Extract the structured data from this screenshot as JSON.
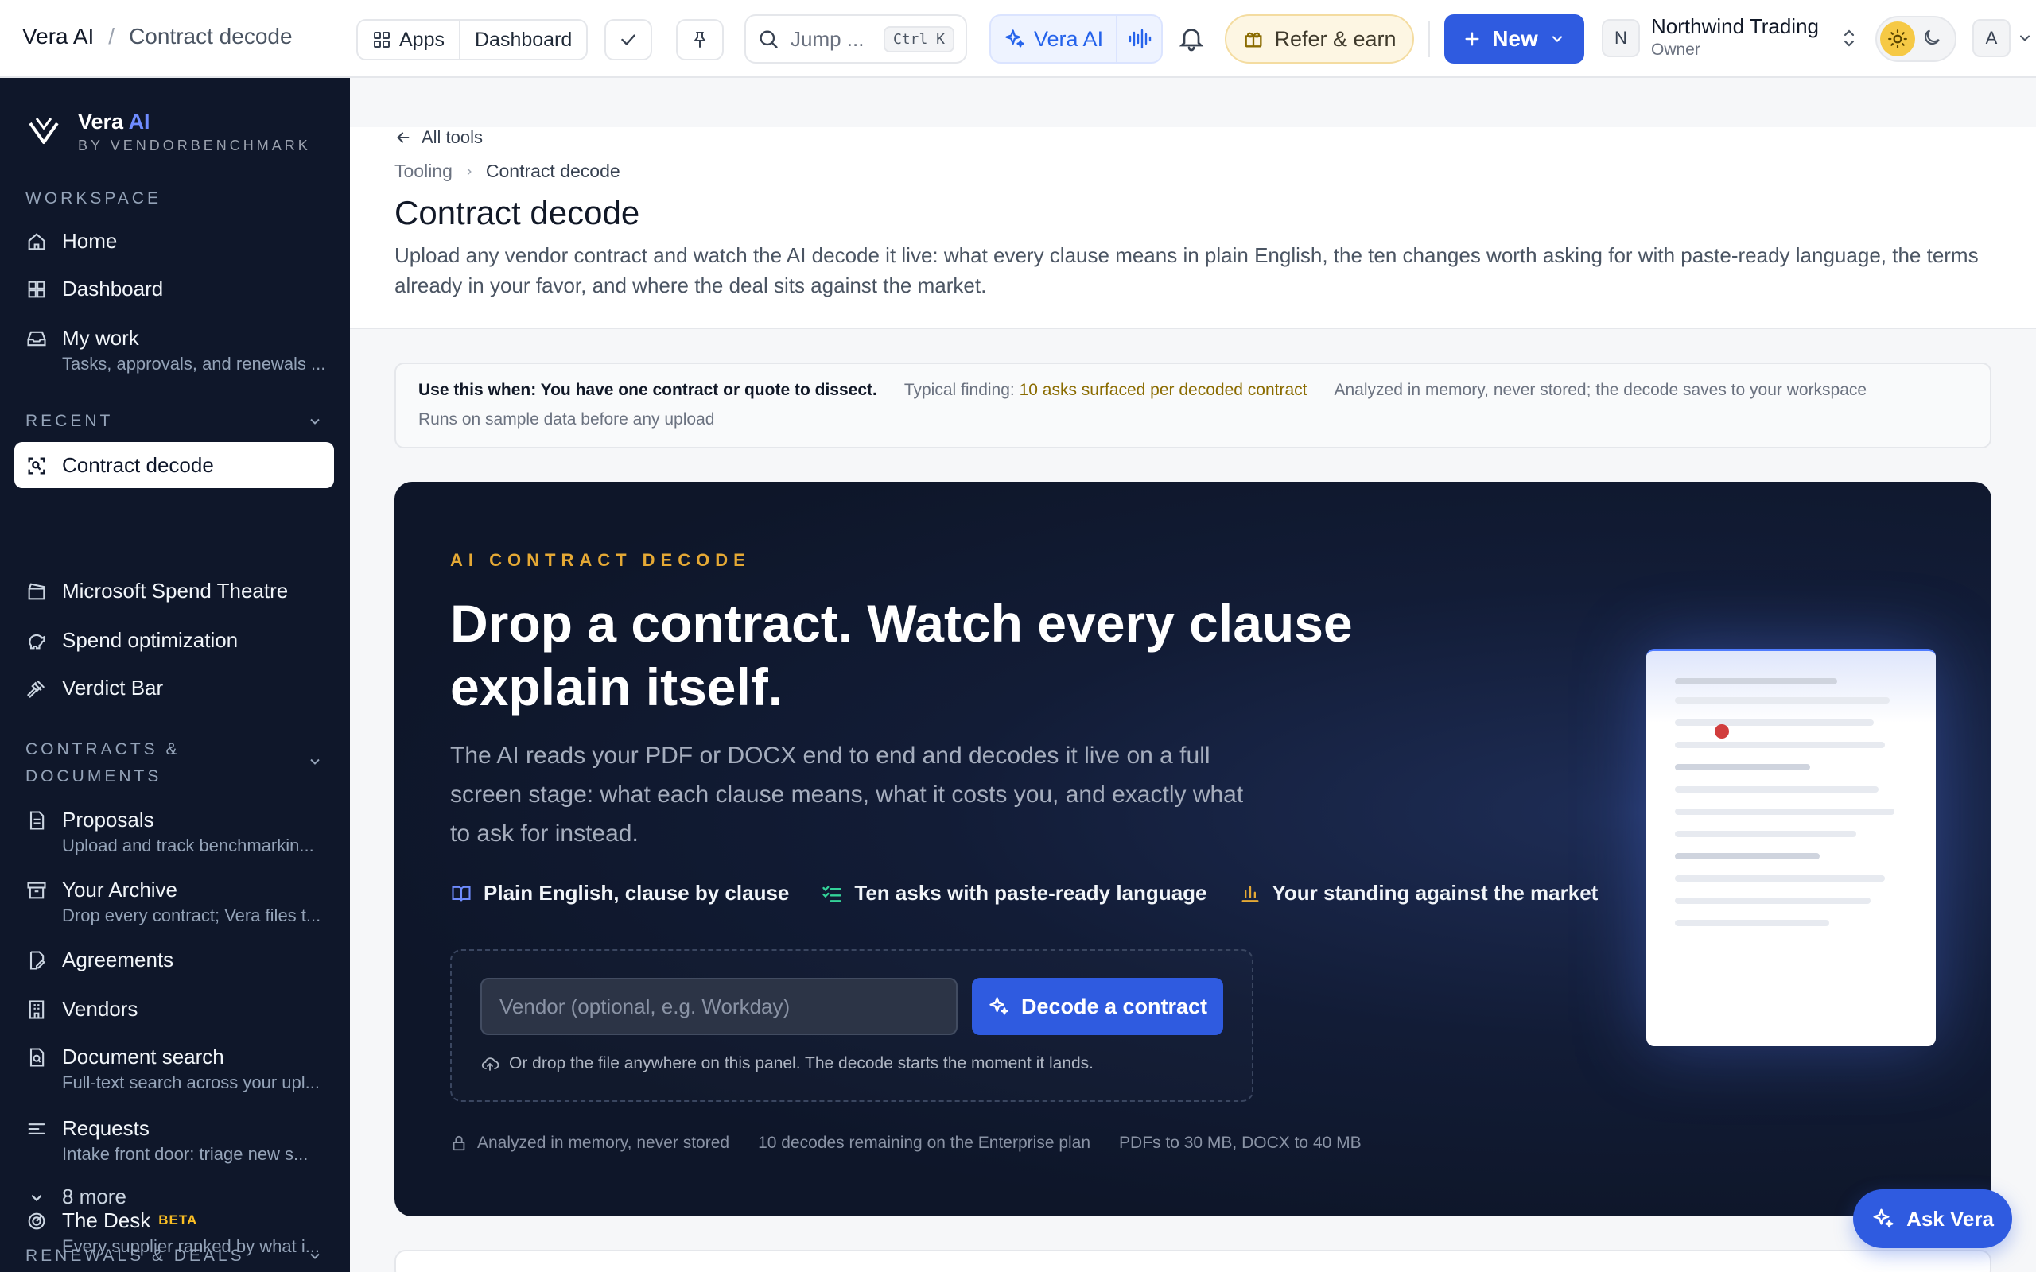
{
  "header": {
    "app_name": "Vera AI",
    "separator": "/",
    "page_name": "Contract decode",
    "apps_label": "Apps",
    "dashboard_label": "Dashboard",
    "search_placeholder": "Jump ...",
    "search_shortcut": "Ctrl K",
    "vera_label": "Vera AI",
    "refer_label": "Refer & earn",
    "new_label": "New",
    "org_initial": "N",
    "org_name": "Northwind Trading",
    "org_role": "Owner",
    "user_initial": "A"
  },
  "sidebar": {
    "brand_name": "Vera",
    "brand_ai": "AI",
    "brand_by": "BY VENDORBENCHMARK",
    "sections": {
      "workspace": "WORKSPACE",
      "recent": "RECENT",
      "contracts": "CONTRACTS &",
      "contracts2": "DOCUMENTS",
      "renewals": "RENEWALS & DEALS"
    },
    "workspace_items": [
      {
        "label": "Home"
      },
      {
        "label": "Dashboard"
      },
      {
        "label": "My work",
        "sub": "Tasks, approvals, and renewals ..."
      }
    ],
    "recent_items": [
      {
        "label": "Contract decode"
      },
      {
        "label": "Microsoft Spend Theatre"
      },
      {
        "label": "Spend optimization"
      },
      {
        "label": "Verdict Bar"
      }
    ],
    "contract_items": [
      {
        "label": "Proposals",
        "sub": "Upload and track benchmarkin..."
      },
      {
        "label": "Your Archive",
        "sub": "Drop every contract; Vera files t..."
      },
      {
        "label": "Agreements"
      },
      {
        "label": "Vendors"
      },
      {
        "label": "Document search",
        "sub": "Full-text search across your upl..."
      },
      {
        "label": "Requests",
        "sub": "Intake front door: triage new s..."
      }
    ],
    "more_label": "8 more",
    "renewal_items": [
      {
        "label": "The Desk",
        "badge": "BETA",
        "sub": "Every supplier ranked by what i..."
      }
    ]
  },
  "main": {
    "back_label": "All tools",
    "breadcrumb": [
      "Tooling",
      "Contract decode"
    ],
    "title": "Contract decode",
    "description": "Upload any vendor contract and watch the AI decode it live: what every clause means in plain English, the ten changes worth asking for with paste-ready language, the terms already in your favor, and where the deal sits against the market.",
    "use_when": "Use this when: You have one contract or quote to dissect.",
    "typical_label": "Typical finding:",
    "typical_value": "10 asks surfaced per decoded contract",
    "privacy_note": "Analyzed in memory, never stored; the decode saves to your workspace",
    "sample_note": "Runs on sample data before any upload"
  },
  "hero": {
    "eyebrow": "AI CONTRACT DECODE",
    "headline": "Drop a contract. Watch every clause explain itself.",
    "lead": "The AI reads your PDF or DOCX end to end and decodes it live on a full screen stage: what each clause means, what it costs you, and exactly what to ask for instead.",
    "features": [
      "Plain English, clause by clause",
      "Ten asks with paste-ready language",
      "Your standing against the market"
    ],
    "vendor_placeholder": "Vendor (optional, e.g. Workday)",
    "decode_label": "Decode a contract",
    "drop_hint": "Or drop the file anywhere on this panel. The decode starts the moment it lands.",
    "footnotes": [
      "Analyzed in memory, never stored",
      "10 decodes remaining on the Enterprise plan",
      "PDFs to 30 MB, DOCX to 40 MB"
    ]
  },
  "ask_label": "Ask Vera",
  "colors": {
    "accent": "#2f5be0",
    "sidebar_bg": "#0f172a",
    "hero_bg": "#121c36",
    "eyebrow": "#e5a935"
  }
}
